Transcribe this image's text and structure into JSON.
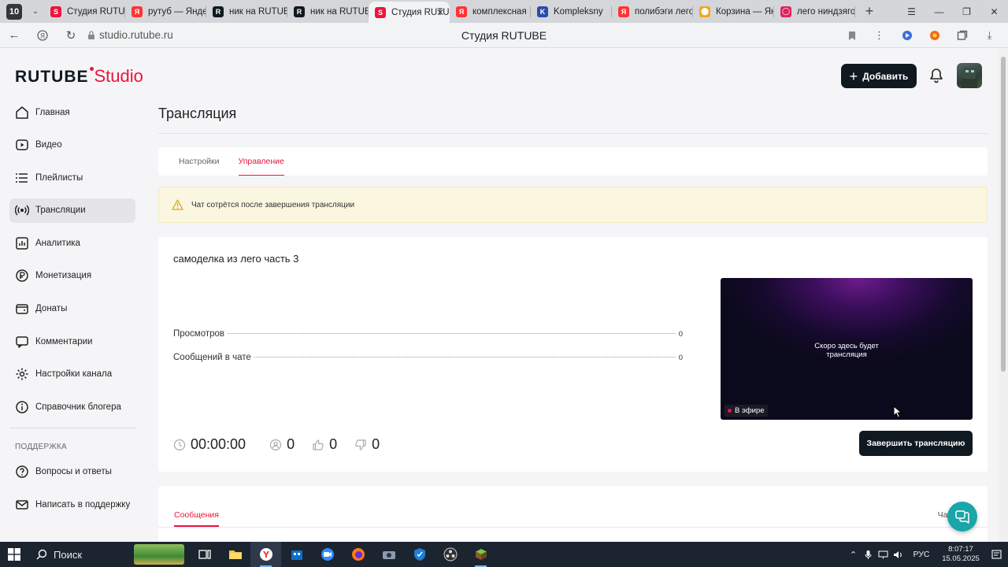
{
  "browser": {
    "tab_counter": "10",
    "tabs": [
      {
        "label": "Студия RUTUBE",
        "favicon": "rutube-studio",
        "color": "#ed143b",
        "glyph": "S"
      },
      {
        "label": "рутуб — Яндекс",
        "favicon": "yandex",
        "color": "#f33",
        "glyph": "Я"
      },
      {
        "label": "ник на RUTUBE",
        "favicon": "rutube",
        "color": "#101820",
        "glyph": "R"
      },
      {
        "label": "ник на RUTUBE",
        "favicon": "rutube",
        "color": "#101820",
        "glyph": "R"
      },
      {
        "label": "Студия RUTUBE",
        "favicon": "rutube-studio",
        "color": "#ed143b",
        "glyph": "S",
        "active": true
      },
      {
        "label": "комплексная",
        "favicon": "yandex",
        "color": "#f33",
        "glyph": "Я"
      },
      {
        "label": "Kompleksny",
        "favicon": "kompleksny",
        "color": "#2b4ba8",
        "glyph": "K"
      },
      {
        "label": "полибэги лего",
        "favicon": "yandex",
        "color": "#f33",
        "glyph": "Я"
      },
      {
        "label": "Корзина — Яндекс",
        "favicon": "market",
        "color": "#f5a623",
        "glyph": "⬤"
      },
      {
        "label": "лего ниндзяго",
        "favicon": "ozon",
        "color": "#e0245e",
        "glyph": "◯"
      }
    ],
    "url": "studio.rutube.ru",
    "page_title": "Студия RUTUBE"
  },
  "header": {
    "logo_main": "RUTUBE",
    "logo_sub": "Studio",
    "add_button": "Добавить"
  },
  "sidebar": {
    "items": [
      {
        "label": "Главная",
        "icon": "home-icon"
      },
      {
        "label": "Видео",
        "icon": "video-icon"
      },
      {
        "label": "Плейлисты",
        "icon": "playlist-icon"
      },
      {
        "label": "Трансляции",
        "icon": "broadcast-icon",
        "active": true
      },
      {
        "label": "Аналитика",
        "icon": "analytics-icon"
      },
      {
        "label": "Монетизация",
        "icon": "monetization-icon"
      },
      {
        "label": "Донаты",
        "icon": "donate-icon"
      },
      {
        "label": "Комментарии",
        "icon": "comments-icon"
      },
      {
        "label": "Настройки канала",
        "icon": "settings-icon"
      },
      {
        "label": "Справочник блогера",
        "icon": "info-icon"
      }
    ],
    "support_heading": "ПОДДЕРЖКА",
    "support_items": [
      {
        "label": "Вопросы и ответы",
        "icon": "help-icon"
      },
      {
        "label": "Написать в поддержку",
        "icon": "mail-icon"
      }
    ]
  },
  "main": {
    "title": "Трансляция",
    "tabs": [
      {
        "label": "Настройки"
      },
      {
        "label": "Управление",
        "active": true
      }
    ],
    "warning": "Чат сотрётся после завершения трансляции",
    "stream_title": "самоделка из лего часть 3",
    "stats": [
      {
        "label": "Просмотров",
        "value": "0"
      },
      {
        "label": "Сообщений в чате",
        "value": "0"
      }
    ],
    "counters": {
      "duration": "00:00:00",
      "viewers": "0",
      "likes": "0",
      "dislikes": "0"
    },
    "preview_text_line1": "Скоро здесь будет",
    "preview_text_line2": "трансляция",
    "live_badge": "В эфире",
    "end_button": "Завершить трансляцию",
    "messages_tab": "Сообщения",
    "chat_label": "Чат"
  },
  "taskbar": {
    "search_label": "Поиск",
    "language": "РУС",
    "time": "8:07:17",
    "date": "15.05.2025"
  },
  "colors": {
    "accent": "#ed143b",
    "dark": "#101820",
    "warning_bg": "#fbf6df",
    "support": "#1aa5a8"
  }
}
